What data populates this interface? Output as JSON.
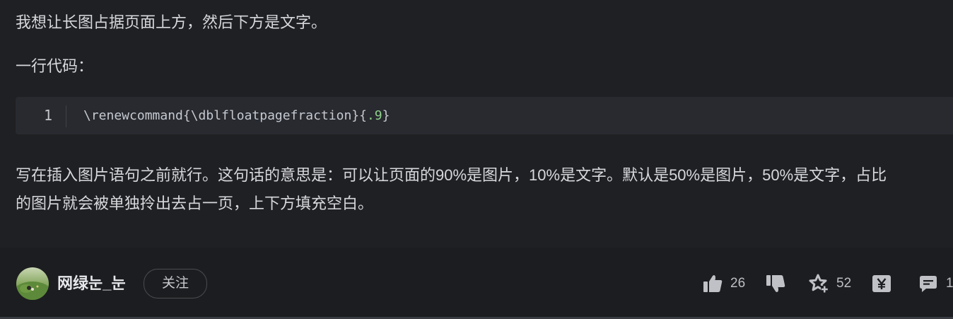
{
  "article": {
    "para1": "我想让长图占据页面上方，然后下方是文字。",
    "para2": "一行代码：",
    "code": {
      "line_number": "1",
      "text_before": "\\renewcommand{\\dblfloatpagefraction}{",
      "text_number": ".9",
      "text_after": "}"
    },
    "para3_line1": "写在插入图片语句之前就行。这句话的意思是：可以让页面的90%是图片，10%是文字。默认是50%是图片，50%是文字，占比",
    "para3_line2": "的图片就会被单独拎出去占一页，上下方填充空白。"
  },
  "footer": {
    "author_name": "网绿눈_눈",
    "follow_label": "关注",
    "like_count": "26",
    "favorite_count": "52",
    "comment_count": "1",
    "icons": {
      "like": "thumbs-up-icon",
      "dislike": "thumbs-down-icon",
      "favorite": "star-plus-icon",
      "reward": "yen-icon",
      "comment": "comment-icon"
    }
  },
  "colors": {
    "background": "#1f2023",
    "text": "#d7d8dc",
    "code_background": "#282a30",
    "code_number": "#8fcf8a",
    "icon": "#c0c1c6"
  }
}
